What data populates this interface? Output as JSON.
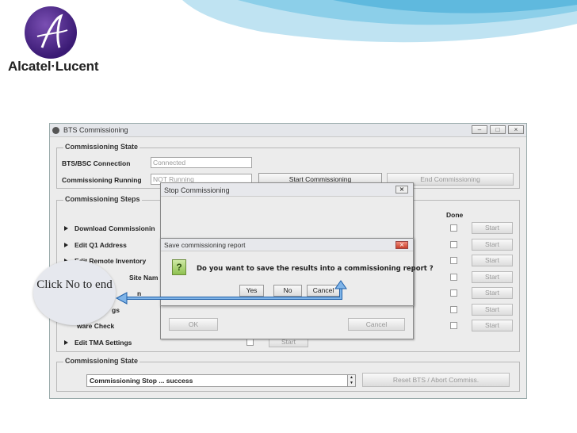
{
  "brand": {
    "name": "Alcatel·Lucent",
    "accent": "#5a2a8c",
    "swoosh": "#7fc6e6"
  },
  "window": {
    "title": "BTS Commissioning",
    "commissioning_state_label": "Commissioning State",
    "connection_label": "BTS/BSC Connection",
    "connection_value": "Connected",
    "running_label": "Commissioning Running",
    "running_value": "NOT Running",
    "start_btn": "Start Commissioning",
    "end_btn": "End Commissioning",
    "steps_label": "Commissioning Steps",
    "done_label": "Done",
    "steps": [
      "Download Commissionin",
      "Edit Q1 Address",
      "Edit Remote Inventory",
      "Site Nam",
      "n",
      "gs",
      "ware Check",
      "Edit TMA Settings"
    ],
    "start_label": "Start",
    "bottom_state_label": "Commissioning State",
    "bottom_state_value": "Commissioning Stop ... success",
    "reset_btn": "Reset BTS / Abort Commiss."
  },
  "stop_dialog": {
    "title": "Stop Commissioning",
    "ok": "OK",
    "cancel": "Cancel"
  },
  "save_dialog": {
    "title": "Save commissioning report",
    "message": "Do you want to save the results into a commissioning report ?",
    "yes": "Yes",
    "no": "No",
    "cancel": "Cancel"
  },
  "callout": {
    "text": "Click No to end"
  }
}
